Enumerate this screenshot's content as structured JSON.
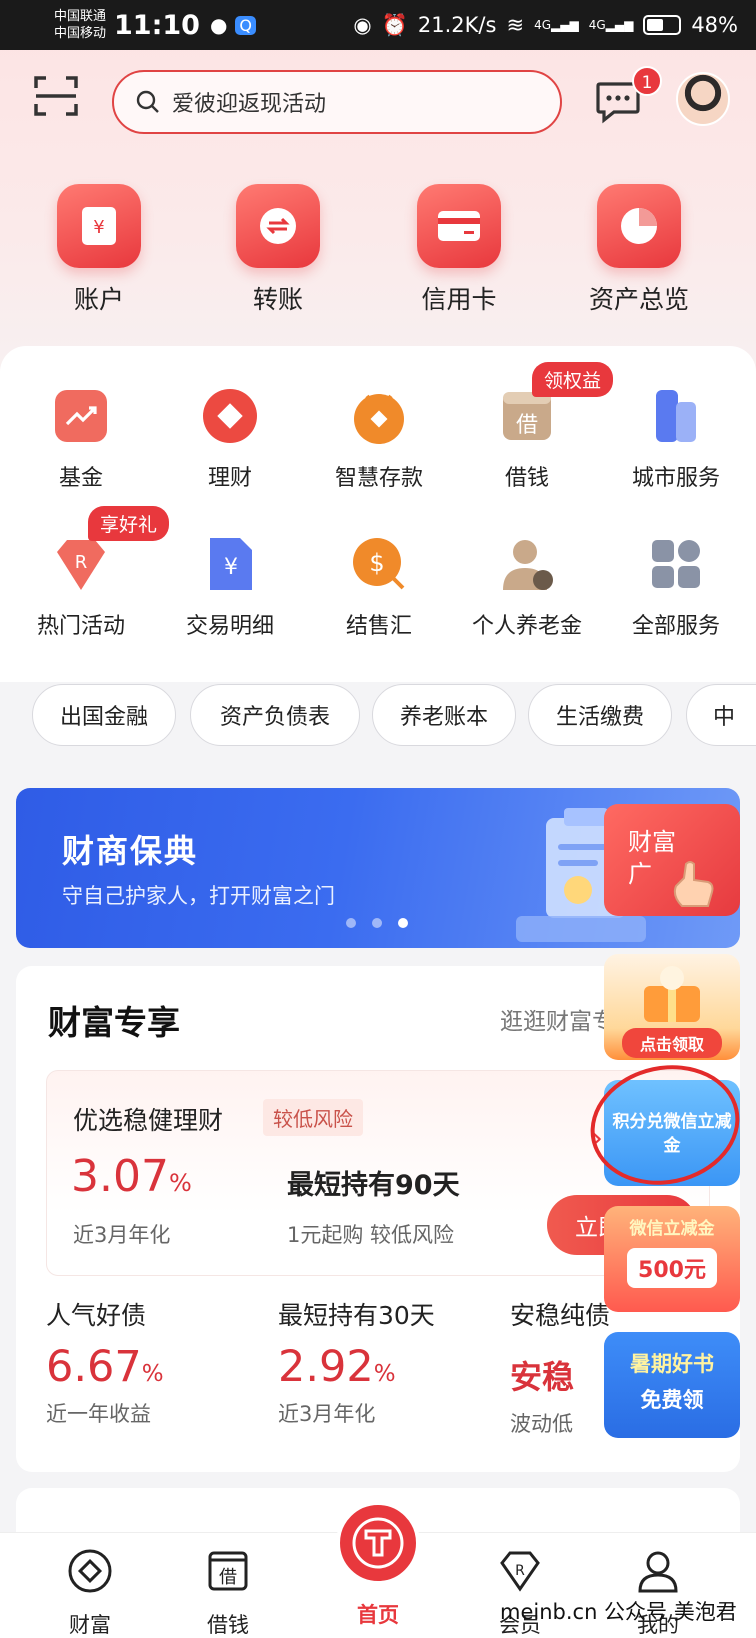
{
  "status_bar": {
    "carrier_1": "中国联通",
    "carrier_2": "中国移动",
    "time": "11:10",
    "net_speed": "21.2K/s",
    "network_1": "4G",
    "network_2": "4G",
    "battery": "48%"
  },
  "header": {
    "search_placeholder": "爱彼迎返现活动",
    "message_badge": "1"
  },
  "quick_actions": [
    {
      "label": "账户",
      "icon": "wallet-icon"
    },
    {
      "label": "转账",
      "icon": "transfer-icon"
    },
    {
      "label": "信用卡",
      "icon": "credit-card-icon"
    },
    {
      "label": "资产总览",
      "icon": "pie-chart-icon"
    }
  ],
  "services": [
    {
      "label": "基金",
      "icon": "fund-trend-icon"
    },
    {
      "label": "理财",
      "icon": "wealth-icon"
    },
    {
      "label": "智慧存款",
      "icon": "deposit-icon"
    },
    {
      "label": "借钱",
      "icon": "borrow-icon",
      "tag": "领权益"
    },
    {
      "label": "城市服务",
      "icon": "city-icon"
    },
    {
      "label": "热门活动",
      "icon": "activity-icon",
      "tag": "享好礼"
    },
    {
      "label": "交易明细",
      "icon": "transaction-detail-icon"
    },
    {
      "label": "结售汇",
      "icon": "exchange-icon"
    },
    {
      "label": "个人养老金",
      "icon": "pension-icon"
    },
    {
      "label": "全部服务",
      "icon": "all-services-icon"
    }
  ],
  "chips": [
    "出国金融",
    "资产负债表",
    "养老账本",
    "生活缴费",
    "中"
  ],
  "banner": {
    "title": "财商保典",
    "subtitle": "守自己护家人，打开财富之门"
  },
  "wealth": {
    "title": "财富专享",
    "more": "逛逛财富专",
    "featured": {
      "name": "优选稳健理财",
      "risk": "较低风险",
      "rate": "3.07",
      "rate_unit": "%",
      "rate_label": "近3月年化",
      "term": "最短持有90天",
      "term_sub": "1元起购 较低风险",
      "button": "立即购"
    },
    "products": [
      {
        "name": "人气好债",
        "rate": "6.67",
        "unit": "%",
        "label": "近一年收益"
      },
      {
        "name": "最短持有30天",
        "rate": "2.92",
        "unit": "%",
        "label": "近3月年化"
      },
      {
        "name": "安稳纯债",
        "rate": "安稳",
        "unit": "",
        "label": "波动低"
      }
    ]
  },
  "floats": {
    "f1_line1": "财富",
    "f1_line2": "广",
    "f2": "点击领取",
    "f3": "积分兑微信立减金",
    "f4_title": "微信立减金",
    "f4_amount": "500元",
    "f5_line1": "暑期好书",
    "f5_line2": "免费领"
  },
  "tabbar": [
    {
      "label": "财富",
      "icon": "wealth-tab-icon"
    },
    {
      "label": "借钱",
      "icon": "borrow-tab-icon"
    },
    {
      "label": "首页",
      "icon": "home-logo-icon"
    },
    {
      "label": "会员",
      "icon": "member-tab-icon"
    },
    {
      "label": "我的",
      "icon": "profile-tab-icon"
    }
  ],
  "watermark": "meinb.cn 公众号 美泡君",
  "colors": {
    "brand_red": "#e8383d",
    "banner_blue": "#2f5ce6"
  }
}
